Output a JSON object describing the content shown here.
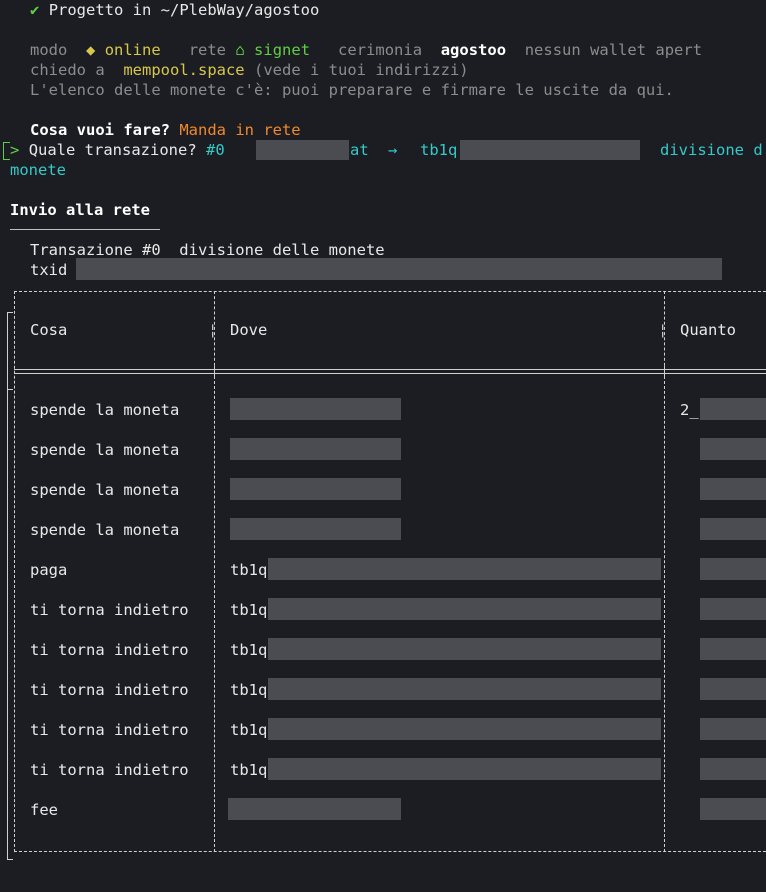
{
  "header": {
    "check": "✔",
    "project_label": "Progetto in ~/PlebWay/agostoo"
  },
  "status": {
    "mode_label": "modo",
    "mode_icon": "◆",
    "mode_value": "online",
    "network_label": "rete",
    "network_icon": "⌂",
    "network_value": "signet",
    "ceremony_label": "cerimonia",
    "ceremony_value": "agostoo",
    "wallet_status": "nessun wallet apert",
    "ask_label": "chiedo a",
    "ask_server": "mempool.space",
    "ask_note": "(vede i tuoi indirizzi)",
    "info_line": "L'elenco delle monete c'è: puoi preparare e firmare le uscite da qui."
  },
  "question": {
    "label": "Cosa vuoi fare?",
    "answer": "Manda in rete",
    "prompt_marker": ">",
    "tx_label": "Quale transazione?",
    "tx_num": "#0",
    "tx_at": "at",
    "tx_arrow": "→",
    "tx_addr_prefix": "tb1q",
    "tx_desc": "divisione d",
    "tx_desc_wrap": "monete"
  },
  "section": {
    "title": "Invio alla rete",
    "underline": "───────────────",
    "tx_title": "Transazione #0  divisione delle monete",
    "txid_label": "txid"
  },
  "table": {
    "headers": [
      "Cosa",
      "Dove",
      "Quanto"
    ],
    "rows": [
      {
        "cosa": "spende la moneta",
        "dove_prefix": "",
        "quanto_prefix": "2_"
      },
      {
        "cosa": "spende la moneta",
        "dove_prefix": "",
        "quanto_prefix": ""
      },
      {
        "cosa": "spende la moneta",
        "dove_prefix": "",
        "quanto_prefix": ""
      },
      {
        "cosa": "spende la moneta",
        "dove_prefix": "",
        "quanto_prefix": ""
      },
      {
        "cosa": "paga",
        "dove_prefix": "tb1q",
        "quanto_prefix": ""
      },
      {
        "cosa": "ti torna indietro",
        "dove_prefix": "tb1q",
        "quanto_prefix": ""
      },
      {
        "cosa": "ti torna indietro",
        "dove_prefix": "tb1q",
        "quanto_prefix": ""
      },
      {
        "cosa": "ti torna indietro",
        "dove_prefix": "tb1q",
        "quanto_prefix": ""
      },
      {
        "cosa": "ti torna indietro",
        "dove_prefix": "tb1q",
        "quanto_prefix": ""
      },
      {
        "cosa": "ti torna indietro",
        "dove_prefix": "tb1q",
        "quanto_prefix": ""
      },
      {
        "cosa": "fee",
        "dove_prefix": "",
        "quanto_prefix": ""
      }
    ]
  },
  "colors": {
    "background": "#1c1d22",
    "green": "#5fcf45",
    "yellow": "#d7c74a",
    "cyan": "#35c9c9",
    "orange": "#f0882c",
    "redacted": "#4b4c52"
  }
}
